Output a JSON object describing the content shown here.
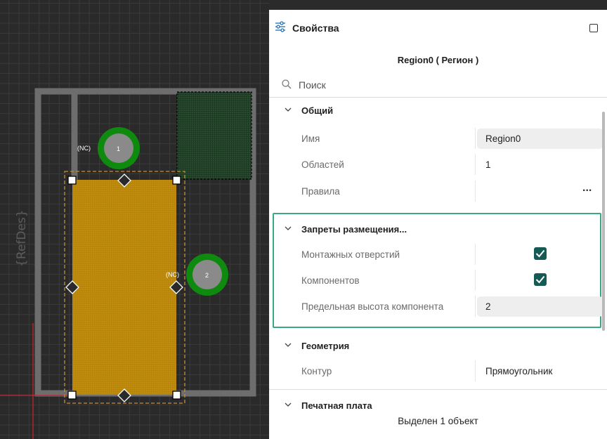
{
  "canvas": {
    "refdes_label": "{RefDes}",
    "pads": [
      {
        "net": "(NC)",
        "number": "1"
      },
      {
        "net": "(NC)",
        "number": "2"
      }
    ]
  },
  "panel": {
    "title": "Свойства",
    "subtitle": "Region0 ( Регион )",
    "search": {
      "placeholder": "Поиск"
    },
    "sections": {
      "general": {
        "title": "Общий",
        "rows": [
          {
            "label": "Имя",
            "value": "Region0"
          },
          {
            "label": "Областей",
            "value": "1"
          },
          {
            "label": "Правила",
            "value": "..."
          }
        ]
      },
      "restrictions": {
        "title": "Запреты размещения...",
        "rows": [
          {
            "label": "Монтажных отверстий",
            "checked": true
          },
          {
            "label": "Компонентов",
            "checked": true
          },
          {
            "label": "Предельная высота компонента",
            "value": "2"
          }
        ]
      },
      "geometry": {
        "title": "Геометрия",
        "rows": [
          {
            "label": "Контур",
            "value": "Прямоугольник"
          }
        ]
      },
      "pcb": {
        "title": "Печатная плата"
      }
    },
    "status": "Выделен 1 объект"
  },
  "colors": {
    "accent_checkbox": "#155a55",
    "highlight_border": "#3aa884",
    "region_fill": "#b8860b",
    "pad_ring": "#0e8a0e"
  }
}
